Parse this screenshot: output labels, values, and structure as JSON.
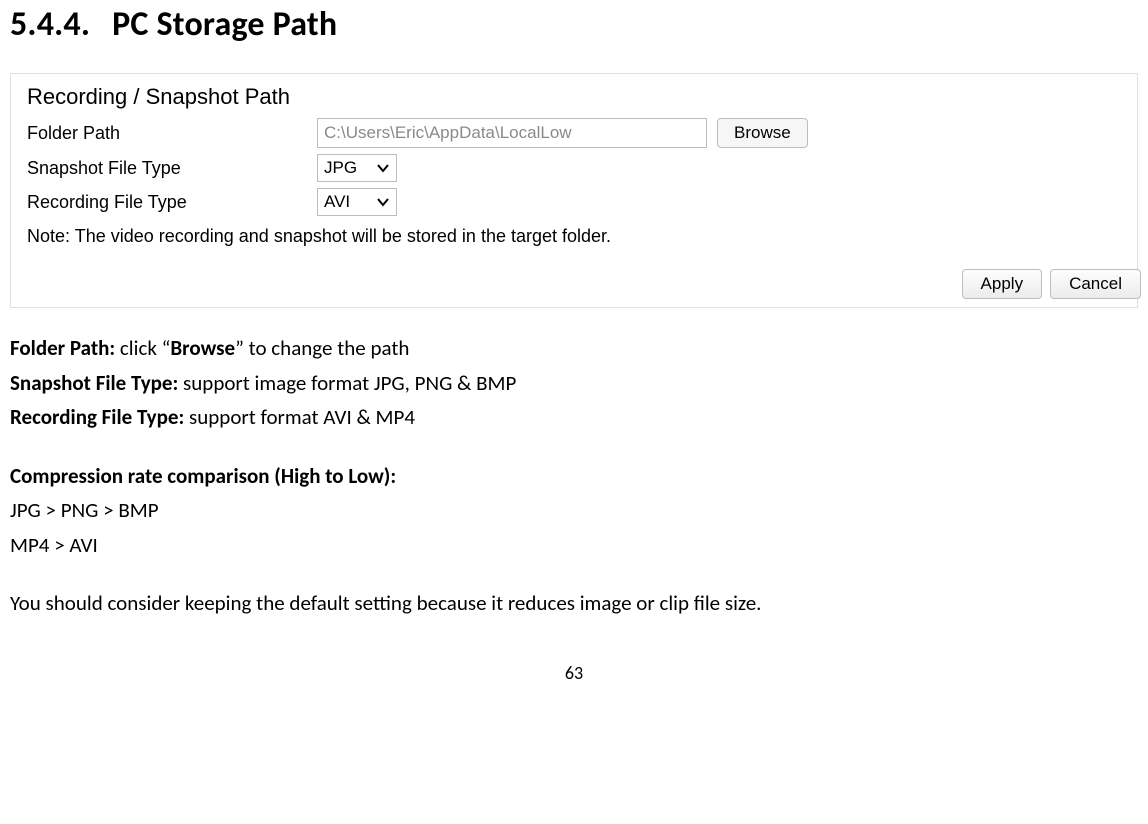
{
  "heading": {
    "number": "5.4.4.",
    "title": "PC Storage Path"
  },
  "panel": {
    "legend": "Recording / Snapshot Path",
    "folderPath": {
      "label": "Folder Path",
      "value": "C:\\Users\\Eric\\AppData\\LocalLow",
      "browse": "Browse"
    },
    "snapshotType": {
      "label": "Snapshot File Type",
      "value": "JPG"
    },
    "recordingType": {
      "label": "Recording File Type",
      "value": "AVI"
    },
    "note": "Note: The video recording and snapshot will be stored in the target folder.",
    "apply": "Apply",
    "cancel": "Cancel"
  },
  "desc": {
    "folder_label": "Folder Path:",
    "folder_text_pre": " click “",
    "folder_browse": "Browse",
    "folder_text_post": "” to change the path",
    "snapshot_label": "Snapshot File Type:",
    "snapshot_text": " support image format JPG, PNG & BMP",
    "recording_label": "Recording File Type:",
    "recording_text": " support format AVI & MP4",
    "compression_heading": "Compression rate comparison (High to Low):",
    "compression_img": "JPG > PNG > BMP",
    "compression_vid": "MP4 > AVI",
    "advice": "You should consider keeping the default setting because it reduces image or clip file size."
  },
  "pageNumber": "63"
}
